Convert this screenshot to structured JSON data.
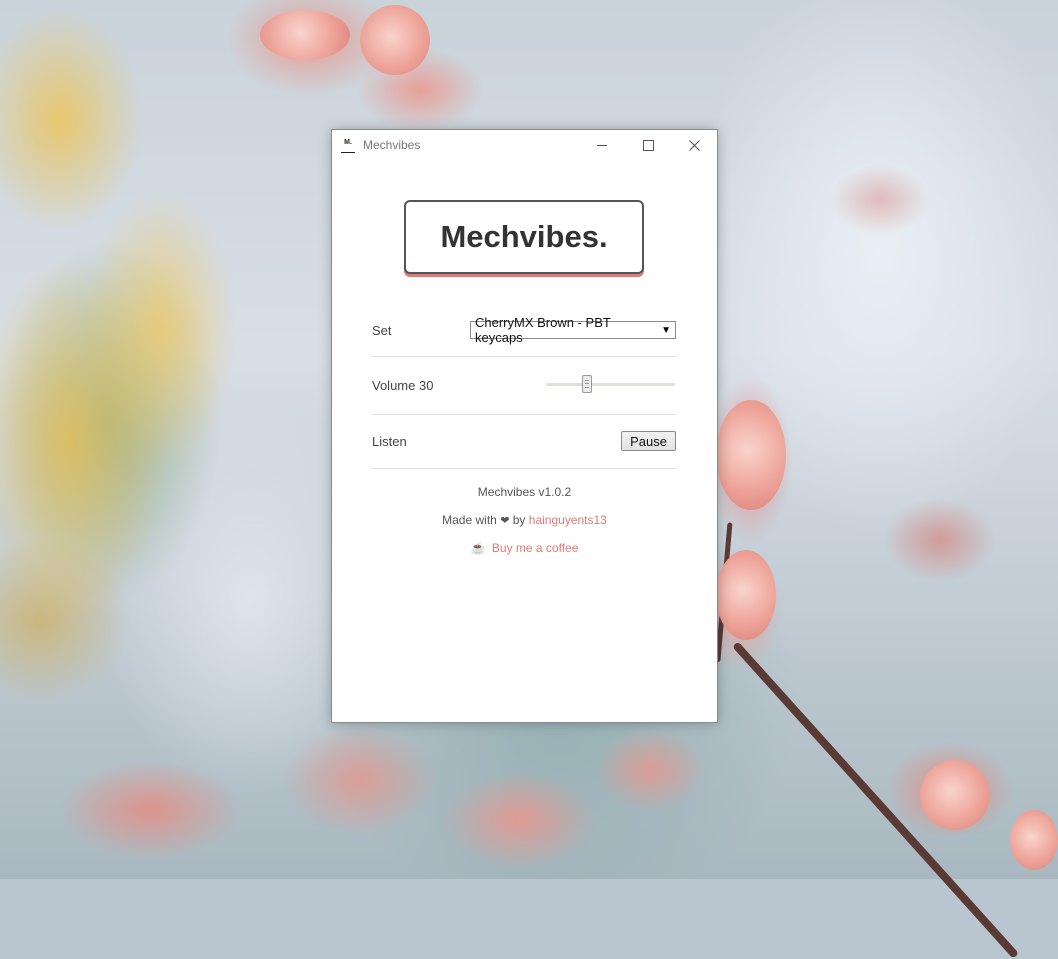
{
  "window": {
    "title": "Mechvibes",
    "icon_text": "M.",
    "controls": {
      "minimize": "minimize-icon",
      "maximize": "maximize-icon",
      "close": "close-icon"
    }
  },
  "logo": {
    "text": "Mechvibes."
  },
  "settings": {
    "set_label": "Set",
    "set_value": "CherryMX Brown - PBT keycaps",
    "volume_label": "Volume 30",
    "volume_value": 30,
    "listen_label": "Listen",
    "pause_label": "Pause"
  },
  "footer": {
    "version": "Mechvibes v1.0.2",
    "made_with": "Made with",
    "heart": "❤",
    "by": "by",
    "author": "hainguyents13",
    "coffee_label": "Buy me a coffee",
    "coffee_icon": "coffee-icon"
  },
  "colors": {
    "accent": "#e07a72",
    "text": "#444444"
  }
}
